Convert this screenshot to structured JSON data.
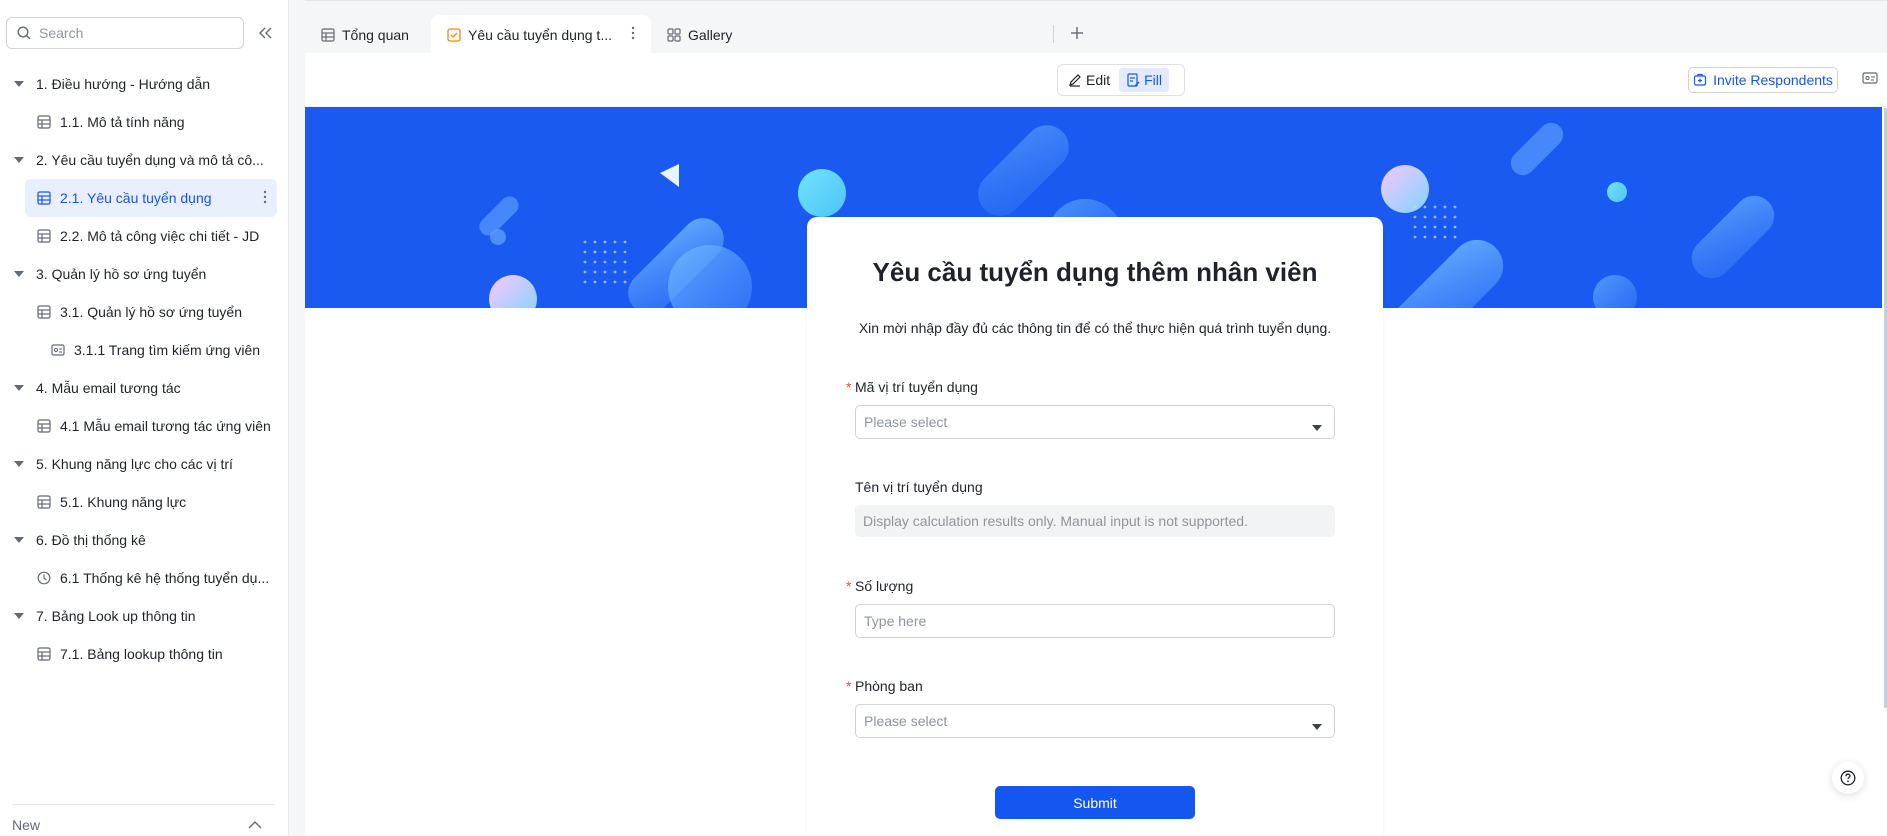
{
  "sidebar": {
    "search_placeholder": "Search",
    "items": [
      {
        "label": "1. Điều hướng - Hướng dẫn",
        "level": 0,
        "icon": "caret-down-icon"
      },
      {
        "label": "1.1. Mô tả tính năng",
        "level": 1,
        "icon": "table-icon"
      },
      {
        "label": "2. Yêu cầu tuyển dụng và mô tả cô...",
        "level": 0,
        "icon": "caret-down-icon"
      },
      {
        "label": "2.1. Yêu cầu tuyển dụng",
        "level": 1,
        "icon": "form-icon",
        "active": true
      },
      {
        "label": "2.2. Mô tả công việc chi tiết - JD",
        "level": 1,
        "icon": "table-icon"
      },
      {
        "label": "3. Quản lý hồ sơ ứng tuyển",
        "level": 0,
        "icon": "caret-down-icon"
      },
      {
        "label": "3.1. Quản lý hồ sơ ứng tuyển",
        "level": 1,
        "icon": "table-icon"
      },
      {
        "label": "3.1.1 Trang tìm kiếm ứng viên",
        "level": 2,
        "icon": "card-icon"
      },
      {
        "label": "4. Mẫu email tương tác",
        "level": 0,
        "icon": "caret-down-icon"
      },
      {
        "label": "4.1 Mẫu email tương tác ứng viên",
        "level": 1,
        "icon": "table-icon"
      },
      {
        "label": "5. Khung năng lực cho các vị trí",
        "level": 0,
        "icon": "caret-down-icon"
      },
      {
        "label": "5.1. Khung năng lực",
        "level": 1,
        "icon": "table-icon"
      },
      {
        "label": "6. Đồ thị thống kê",
        "level": 0,
        "icon": "caret-down-icon"
      },
      {
        "label": "6.1 Thống kê hệ thống tuyển dụ...",
        "level": 1,
        "icon": "dashboard-icon"
      },
      {
        "label": "7. Bảng Look up thông tin",
        "level": 0,
        "icon": "caret-down-icon"
      },
      {
        "label": "7.1. Bảng lookup thông tin",
        "level": 1,
        "icon": "table-icon"
      }
    ],
    "footer_label": "New"
  },
  "tabs": [
    {
      "label": "Tổng quan",
      "icon": "grid-table-icon"
    },
    {
      "label": "Yêu cầu tuyển dụng t...",
      "icon": "form-check-icon",
      "active": true
    },
    {
      "label": "Gallery",
      "icon": "gallery-icon"
    }
  ],
  "toolbar": {
    "edit_label": "Edit",
    "fill_label": "Fill",
    "invite_label": "Invite Respondents"
  },
  "form": {
    "title": "Yêu cầu tuyển dụng thêm nhân viên",
    "description": "Xin mời nhập đầy đủ các thông tin để có thể thực hiện quá trình tuyển dụng.",
    "fields": [
      {
        "label": "Mã vị trí tuyển dụng",
        "required": true,
        "type": "select",
        "placeholder": "Please select"
      },
      {
        "label": "Tên vị trí tuyển dụng",
        "required": false,
        "type": "readonly",
        "placeholder": "Display calculation results only. Manual input is not supported."
      },
      {
        "label": "Số lượng",
        "required": true,
        "type": "text",
        "placeholder": "Type here"
      },
      {
        "label": "Phòng ban",
        "required": true,
        "type": "select",
        "placeholder": "Please select"
      }
    ],
    "submit_label": "Submit"
  },
  "colors": {
    "accent": "#1456f0",
    "banner": "#1a5af0",
    "required": "#f54a45"
  }
}
